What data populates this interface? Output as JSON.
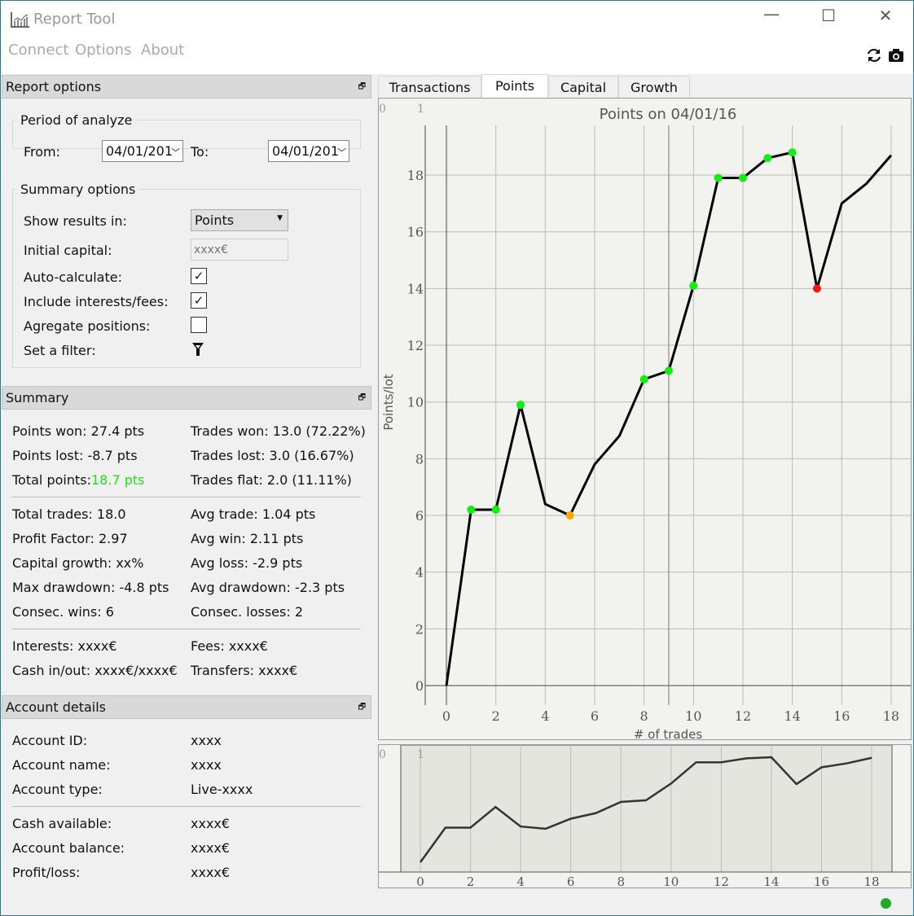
{
  "window": {
    "title": "Report Tool",
    "icon": "chart-app-icon"
  },
  "menu": [
    "Connect",
    "Options",
    "About"
  ],
  "toolbar": {
    "refresh_icon": "refresh-icon",
    "camera_icon": "camera-icon"
  },
  "report_options": {
    "header": "Report options",
    "period": {
      "title": "Period of analyze",
      "from_label": "From:",
      "from_value": "04/01/201",
      "to_label": "To:",
      "to_value": "04/01/201"
    },
    "summary_options": {
      "title": "Summary options",
      "show_results_label": "Show results in:",
      "show_results_value": "Points",
      "initial_capital_label": "Initial capital:",
      "initial_capital_placeholder": "xxxx€",
      "auto_calc_label": "Auto-calculate:",
      "auto_calc": true,
      "include_fees_label": "Include interests/fees:",
      "include_fees": true,
      "aggregate_label": "Agregate positions:",
      "aggregate": false,
      "filter_label": "Set a filter:"
    }
  },
  "summary": {
    "header": "Summary",
    "rows1": [
      [
        "Points won: 27.4 pts",
        "Trades won: 13.0 (72.22%)"
      ],
      [
        "Points lost: -8.7 pts",
        "Trades lost: 3.0 (16.67%)"
      ],
      [
        "Total points: ",
        "Trades flat: 2.0 (11.11%)"
      ]
    ],
    "total_points_value": "18.7 pts",
    "rows2": [
      [
        "Total trades: 18.0",
        "Avg trade: 1.04 pts"
      ],
      [
        "Profit Factor: 2.97",
        "Avg win: 2.11 pts"
      ],
      [
        "Capital growth: xx%",
        "Avg loss: -2.9 pts"
      ],
      [
        "Max drawdown: -4.8 pts",
        "Avg drawdown: -2.3 pts"
      ],
      [
        "Consec. wins: 6",
        "Consec. losses: 2"
      ]
    ],
    "rows3": [
      [
        "Interests: xxxx€",
        "Fees: xxxx€"
      ],
      [
        "Cash in/out: xxxx€/xxxx€",
        "Transfers: xxxx€"
      ]
    ]
  },
  "account": {
    "header": "Account details",
    "rows1": [
      [
        "Account ID:",
        "xxxx"
      ],
      [
        "Account name:",
        "xxxx"
      ],
      [
        "Account type:",
        "Live-xxxx"
      ]
    ],
    "rows2": [
      [
        "Cash available:",
        "xxxx€"
      ],
      [
        "Account balance:",
        "xxxx€"
      ],
      [
        "Profit/loss:",
        "xxxx€"
      ]
    ]
  },
  "tabs": [
    "Transactions",
    "Points",
    "Capital",
    "Growth"
  ],
  "active_tab": "Points",
  "status": {
    "color": "#22aa22"
  },
  "chart_data": {
    "type": "line",
    "title": "Points on 04/01/16",
    "xlabel": "# of trades",
    "ylabel": "Points/lot",
    "corner_labels": [
      "0",
      "1"
    ],
    "x": [
      0,
      1,
      2,
      3,
      4,
      5,
      6,
      7,
      8,
      9,
      10,
      11,
      12,
      13,
      14,
      15,
      16,
      17,
      18
    ],
    "values": [
      0,
      6.2,
      6.2,
      9.9,
      6.4,
      6.0,
      7.8,
      8.8,
      10.8,
      11.1,
      14.1,
      17.9,
      17.9,
      18.6,
      18.8,
      14.0,
      17.0,
      17.7,
      18.7
    ],
    "markers": [
      null,
      "green",
      "green",
      "green",
      null,
      "orange",
      null,
      null,
      "green",
      "green",
      "green",
      "green",
      "green",
      "green",
      "green",
      "red",
      null,
      null,
      null
    ],
    "marker_colors": {
      "green": "#11ee11",
      "orange": "#ffa500",
      "red": "#ff1111"
    },
    "xticks": [
      0,
      2,
      4,
      6,
      8,
      10,
      12,
      14,
      16,
      18
    ],
    "yticks": [
      0,
      2,
      4,
      6,
      8,
      10,
      12,
      14,
      16,
      18
    ],
    "xlim": [
      -0.85,
      18.85
    ],
    "ylim": [
      0,
      19.7
    ],
    "cursor_x": 9,
    "grid": true
  }
}
